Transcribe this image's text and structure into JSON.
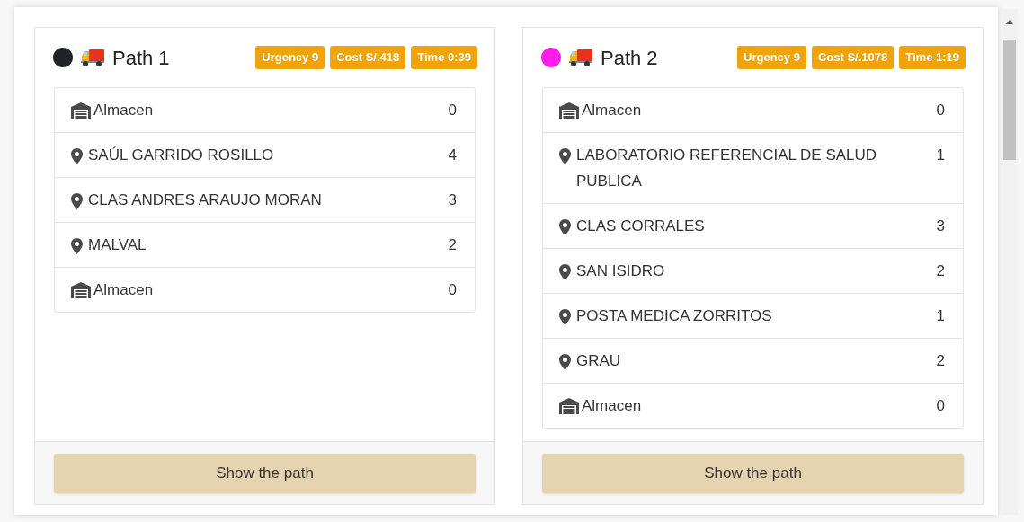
{
  "paths": [
    {
      "title": "Path 1",
      "color": "#1f2328",
      "badges": [
        "Urgency 9",
        "Cost S/.418",
        "Time 0:39"
      ],
      "stops": [
        {
          "kind": "warehouse",
          "name": "Almacen",
          "value": "0"
        },
        {
          "kind": "location",
          "name": "SAÚL GARRIDO ROSILLO",
          "value": "4"
        },
        {
          "kind": "location",
          "name": "CLAS ANDRES ARAUJO MORAN",
          "value": "3"
        },
        {
          "kind": "location",
          "name": "MALVAL",
          "value": "2"
        },
        {
          "kind": "warehouse",
          "name": "Almacen",
          "value": "0"
        }
      ],
      "button": "Show the path"
    },
    {
      "title": "Path 2",
      "color": "#ff1ee8",
      "badges": [
        "Urgency 9",
        "Cost S/.1078",
        "Time 1:19"
      ],
      "stops": [
        {
          "kind": "warehouse",
          "name": "Almacen",
          "value": "0"
        },
        {
          "kind": "location",
          "name": "LABORATORIO REFERENCIAL DE SALUD PUBLICA",
          "value": "1"
        },
        {
          "kind": "location",
          "name": "CLAS CORRALES",
          "value": "3"
        },
        {
          "kind": "location",
          "name": "SAN ISIDRO",
          "value": "2"
        },
        {
          "kind": "location",
          "name": "POSTA MEDICA ZORRITOS",
          "value": "1"
        },
        {
          "kind": "location",
          "name": "GRAU",
          "value": "2"
        },
        {
          "kind": "warehouse",
          "name": "Almacen",
          "value": "0"
        }
      ],
      "button": "Show the path"
    }
  ]
}
